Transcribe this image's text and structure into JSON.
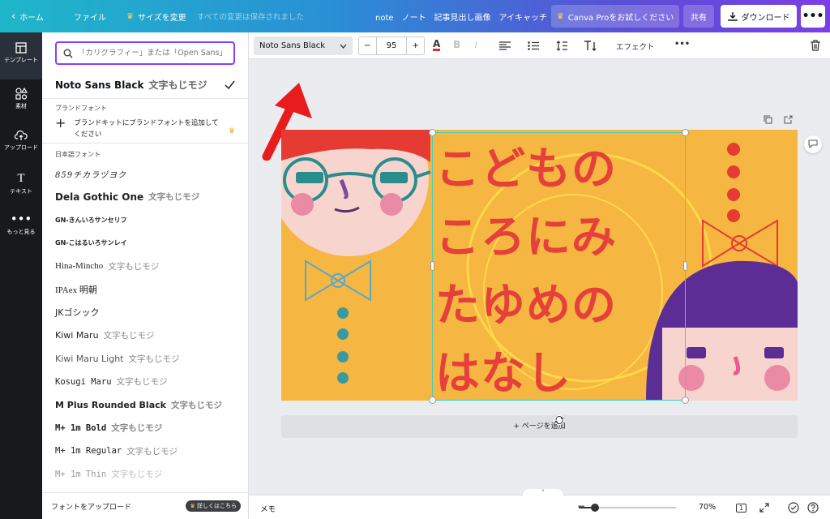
{
  "topbar": {
    "home": "ホーム",
    "file": "ファイル",
    "resize": "サイズを変更",
    "saved": "すべての変更は保存されました",
    "title": "note　ノート　記事見出し画像　アイキャッチ",
    "pro": "Canva Proをお試しください",
    "share": "共有",
    "download": "ダウンロード",
    "more": "•••"
  },
  "rail": {
    "items": [
      {
        "label": "テンプレート",
        "icon": "template-icon"
      },
      {
        "label": "素材",
        "icon": "elements-icon"
      },
      {
        "label": "アップロード",
        "icon": "upload-icon"
      },
      {
        "label": "テキスト",
        "icon": "text-icon"
      },
      {
        "label": "もっと見る",
        "icon": "more-icon"
      }
    ]
  },
  "panel": {
    "search_placeholder": "「カリグラフィー」または「Open Sans」",
    "selected_font": "Noto Sans Black",
    "selected_sample": "文字もじモジ",
    "brand_label": "ブランドフォント",
    "brand_add": "ブランドキットにブランドフォントを追加してください",
    "jp_label": "日本語フォント",
    "fonts": [
      {
        "name": "859チカラヅヨク",
        "sample": ""
      },
      {
        "name": "Dela Gothic One",
        "sample": "文字もじモジ"
      },
      {
        "name": "GN-きんいろサンセリフ",
        "sample": ""
      },
      {
        "name": "GN-こはるいろサンレイ",
        "sample": ""
      },
      {
        "name": "Hina-Mincho",
        "sample": "文字もじモジ"
      },
      {
        "name": "IPAex 明朝",
        "sample": ""
      },
      {
        "name": "JKゴシック",
        "sample": ""
      },
      {
        "name": "Kiwi Maru",
        "sample": "文字もじモジ"
      },
      {
        "name": "Kiwi Maru Light",
        "sample": "文字もじモジ"
      },
      {
        "name": "Kosugi Maru",
        "sample": "文字もじモジ"
      },
      {
        "name": "M Plus Rounded Black",
        "sample": "文字もじモジ"
      },
      {
        "name": "M+ 1m Bold",
        "sample": "文字もじモジ"
      },
      {
        "name": "M+ 1m Regular",
        "sample": "文字もじモジ"
      },
      {
        "name": "M+ 1m Thin",
        "sample": "文字もじモジ"
      }
    ],
    "upload_font": "フォントをアップロード",
    "learn_more": "詳しくはこちら"
  },
  "toolbar": {
    "font": "Noto Sans Black",
    "size": "95",
    "minus": "−",
    "plus": "+",
    "effect": "エフェクト",
    "more": "•••"
  },
  "design": {
    "lines": [
      "こどもの",
      "ころにみ",
      "たゆめの",
      "はなし"
    ],
    "text_color": "#e5403a",
    "bg_color": "#f6b642"
  },
  "canvas": {
    "add_page": "+ ページを追加"
  },
  "bottombar": {
    "memo": "メモ",
    "zoom": "70%",
    "zoom_value": 0.7,
    "page_count": "1"
  },
  "colors": {
    "accent": "#8b3dff",
    "arrow": "#e81c1c"
  }
}
